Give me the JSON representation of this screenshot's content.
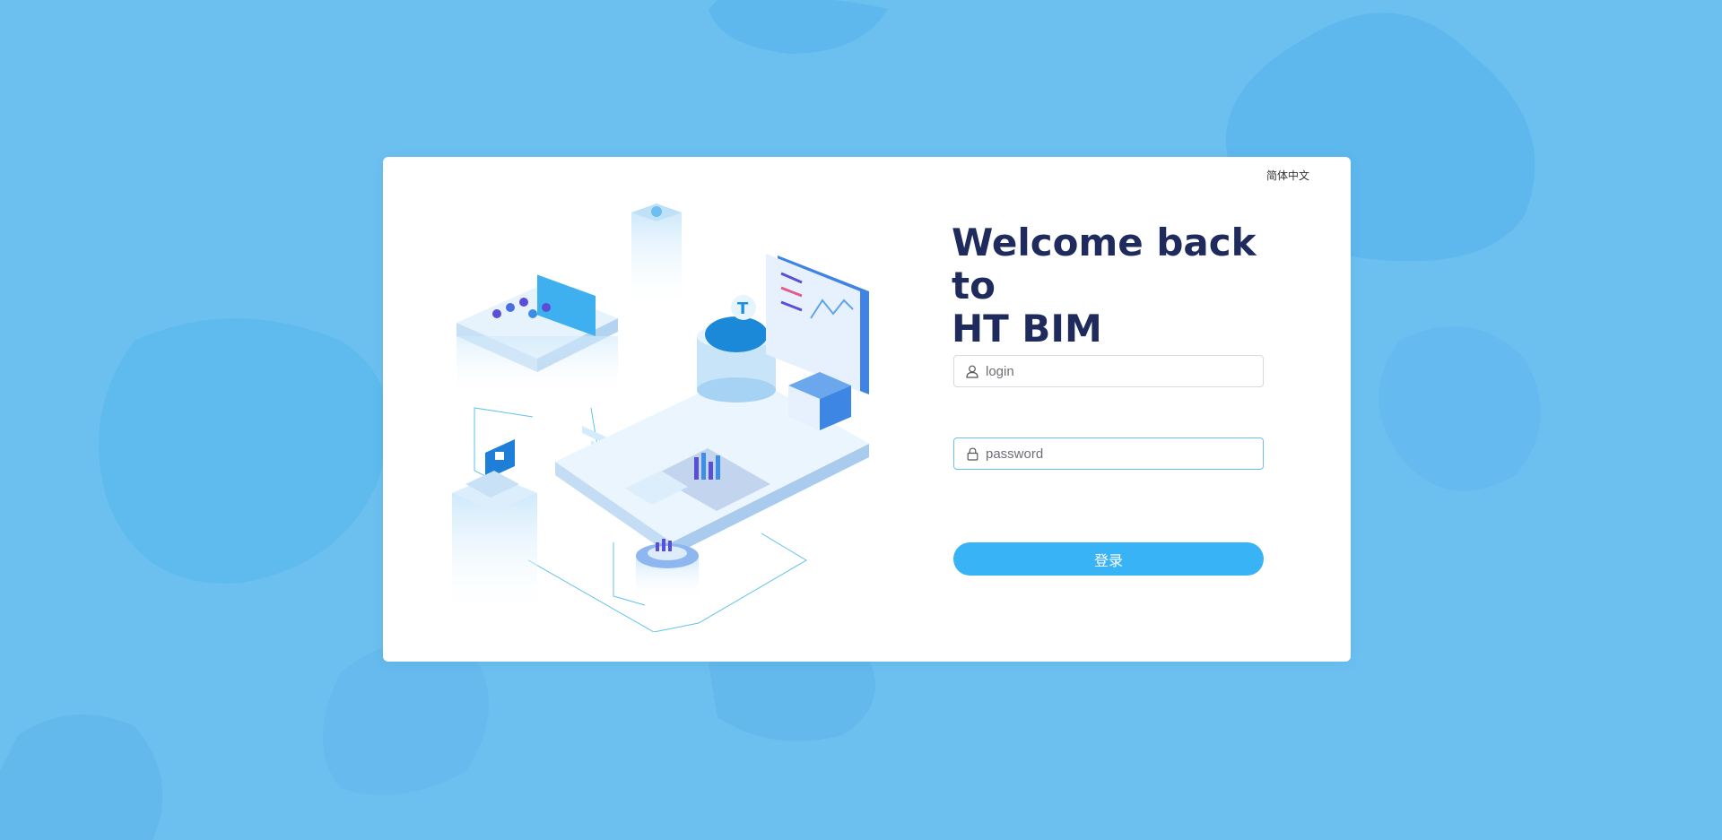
{
  "language_switch": {
    "label": "简体中文"
  },
  "welcome": {
    "line1": "Welcome back to",
    "line2": "HT BIM"
  },
  "login_field": {
    "placeholder": "login",
    "value": "",
    "icon": "user-icon"
  },
  "password_field": {
    "placeholder": "password",
    "value": "",
    "icon": "lock-icon"
  },
  "submit": {
    "label": "登录"
  },
  "colors": {
    "background": "#6cc0f0",
    "title": "#1e2b5c",
    "button": "#38b3f5",
    "focus_border": "#6fc1ec"
  }
}
